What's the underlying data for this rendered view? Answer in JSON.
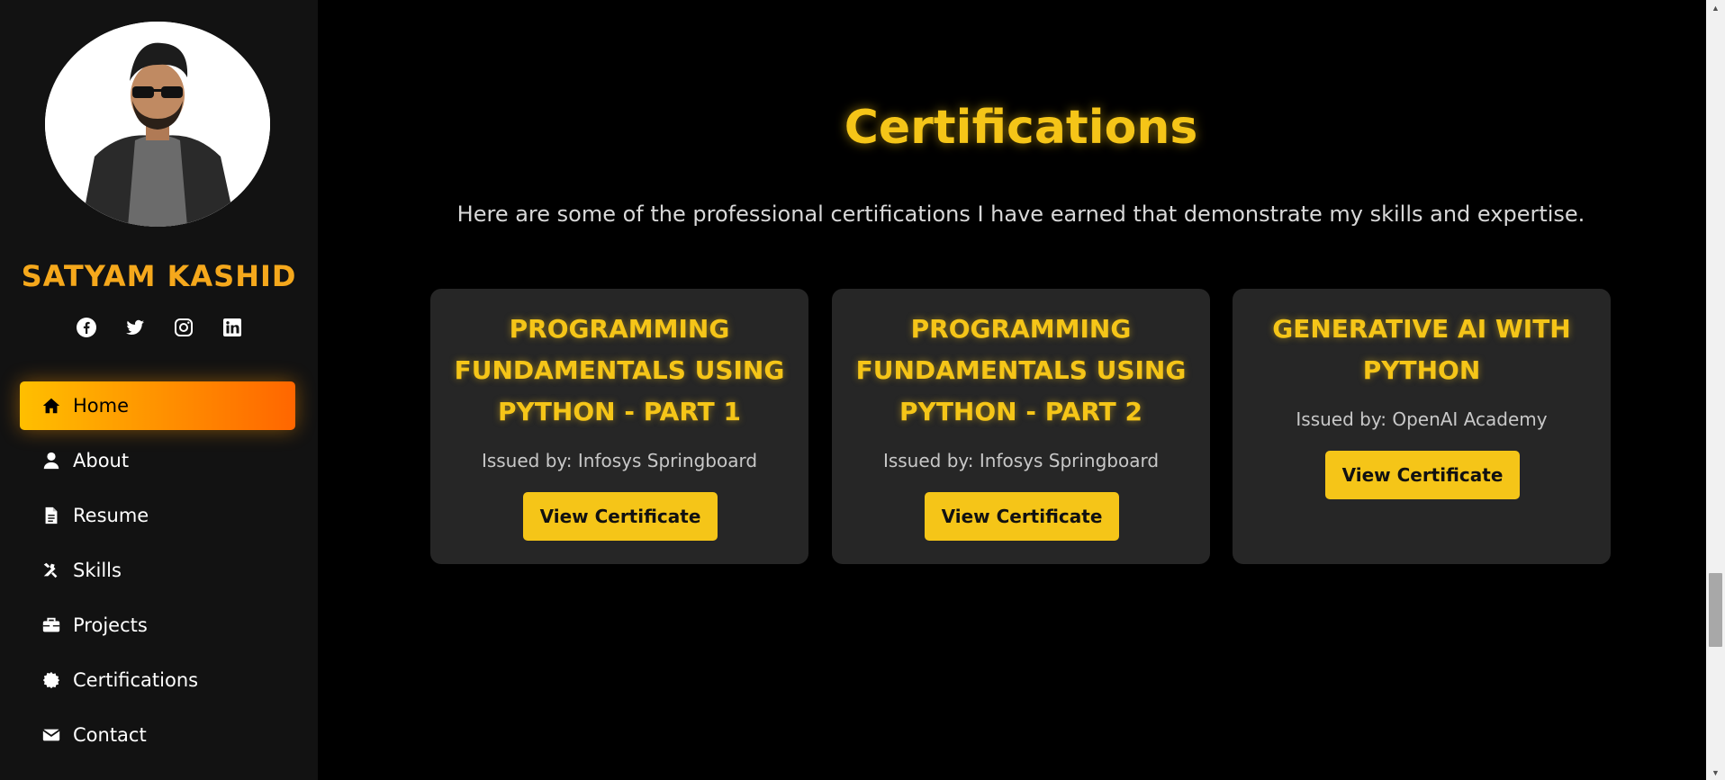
{
  "profile": {
    "name": "SATYAM KASHID"
  },
  "social": [
    {
      "icon": "facebook-icon"
    },
    {
      "icon": "twitter-icon"
    },
    {
      "icon": "instagram-icon"
    },
    {
      "icon": "linkedin-icon"
    }
  ],
  "nav": {
    "items": [
      {
        "label": "Home",
        "icon": "home-icon",
        "active": true
      },
      {
        "label": "About",
        "icon": "user-icon"
      },
      {
        "label": "Resume",
        "icon": "file-icon"
      },
      {
        "label": "Skills",
        "icon": "tools-icon"
      },
      {
        "label": "Projects",
        "icon": "briefcase-icon"
      },
      {
        "label": "Certifications",
        "icon": "certificate-icon"
      },
      {
        "label": "Contact",
        "icon": "envelope-icon"
      }
    ]
  },
  "section": {
    "title": "Certifications",
    "subtitle": "Here are some of the professional certifications I have earned that demonstrate my skills and expertise."
  },
  "certificates": [
    {
      "title": "PROGRAMMING FUNDAMENTALS USING PYTHON - PART 1",
      "issuer": "Issued by: Infosys Springboard",
      "button": "View Certificate"
    },
    {
      "title": "PROGRAMMING FUNDAMENTALS USING PYTHON - PART 2",
      "issuer": "Issued by: Infosys Springboard",
      "button": "View Certificate"
    },
    {
      "title": "GENERATIVE AI WITH PYTHON",
      "issuer": "Issued by: OpenAI Academy",
      "button": "View Certificate"
    }
  ],
  "colors": {
    "accent": "#f5c518",
    "name_orange": "#f5a81c",
    "active_gradient_start": "#ffbf00",
    "active_gradient_end": "#ff6600",
    "sidebar_bg": "#121212",
    "card_bg": "#262626"
  }
}
